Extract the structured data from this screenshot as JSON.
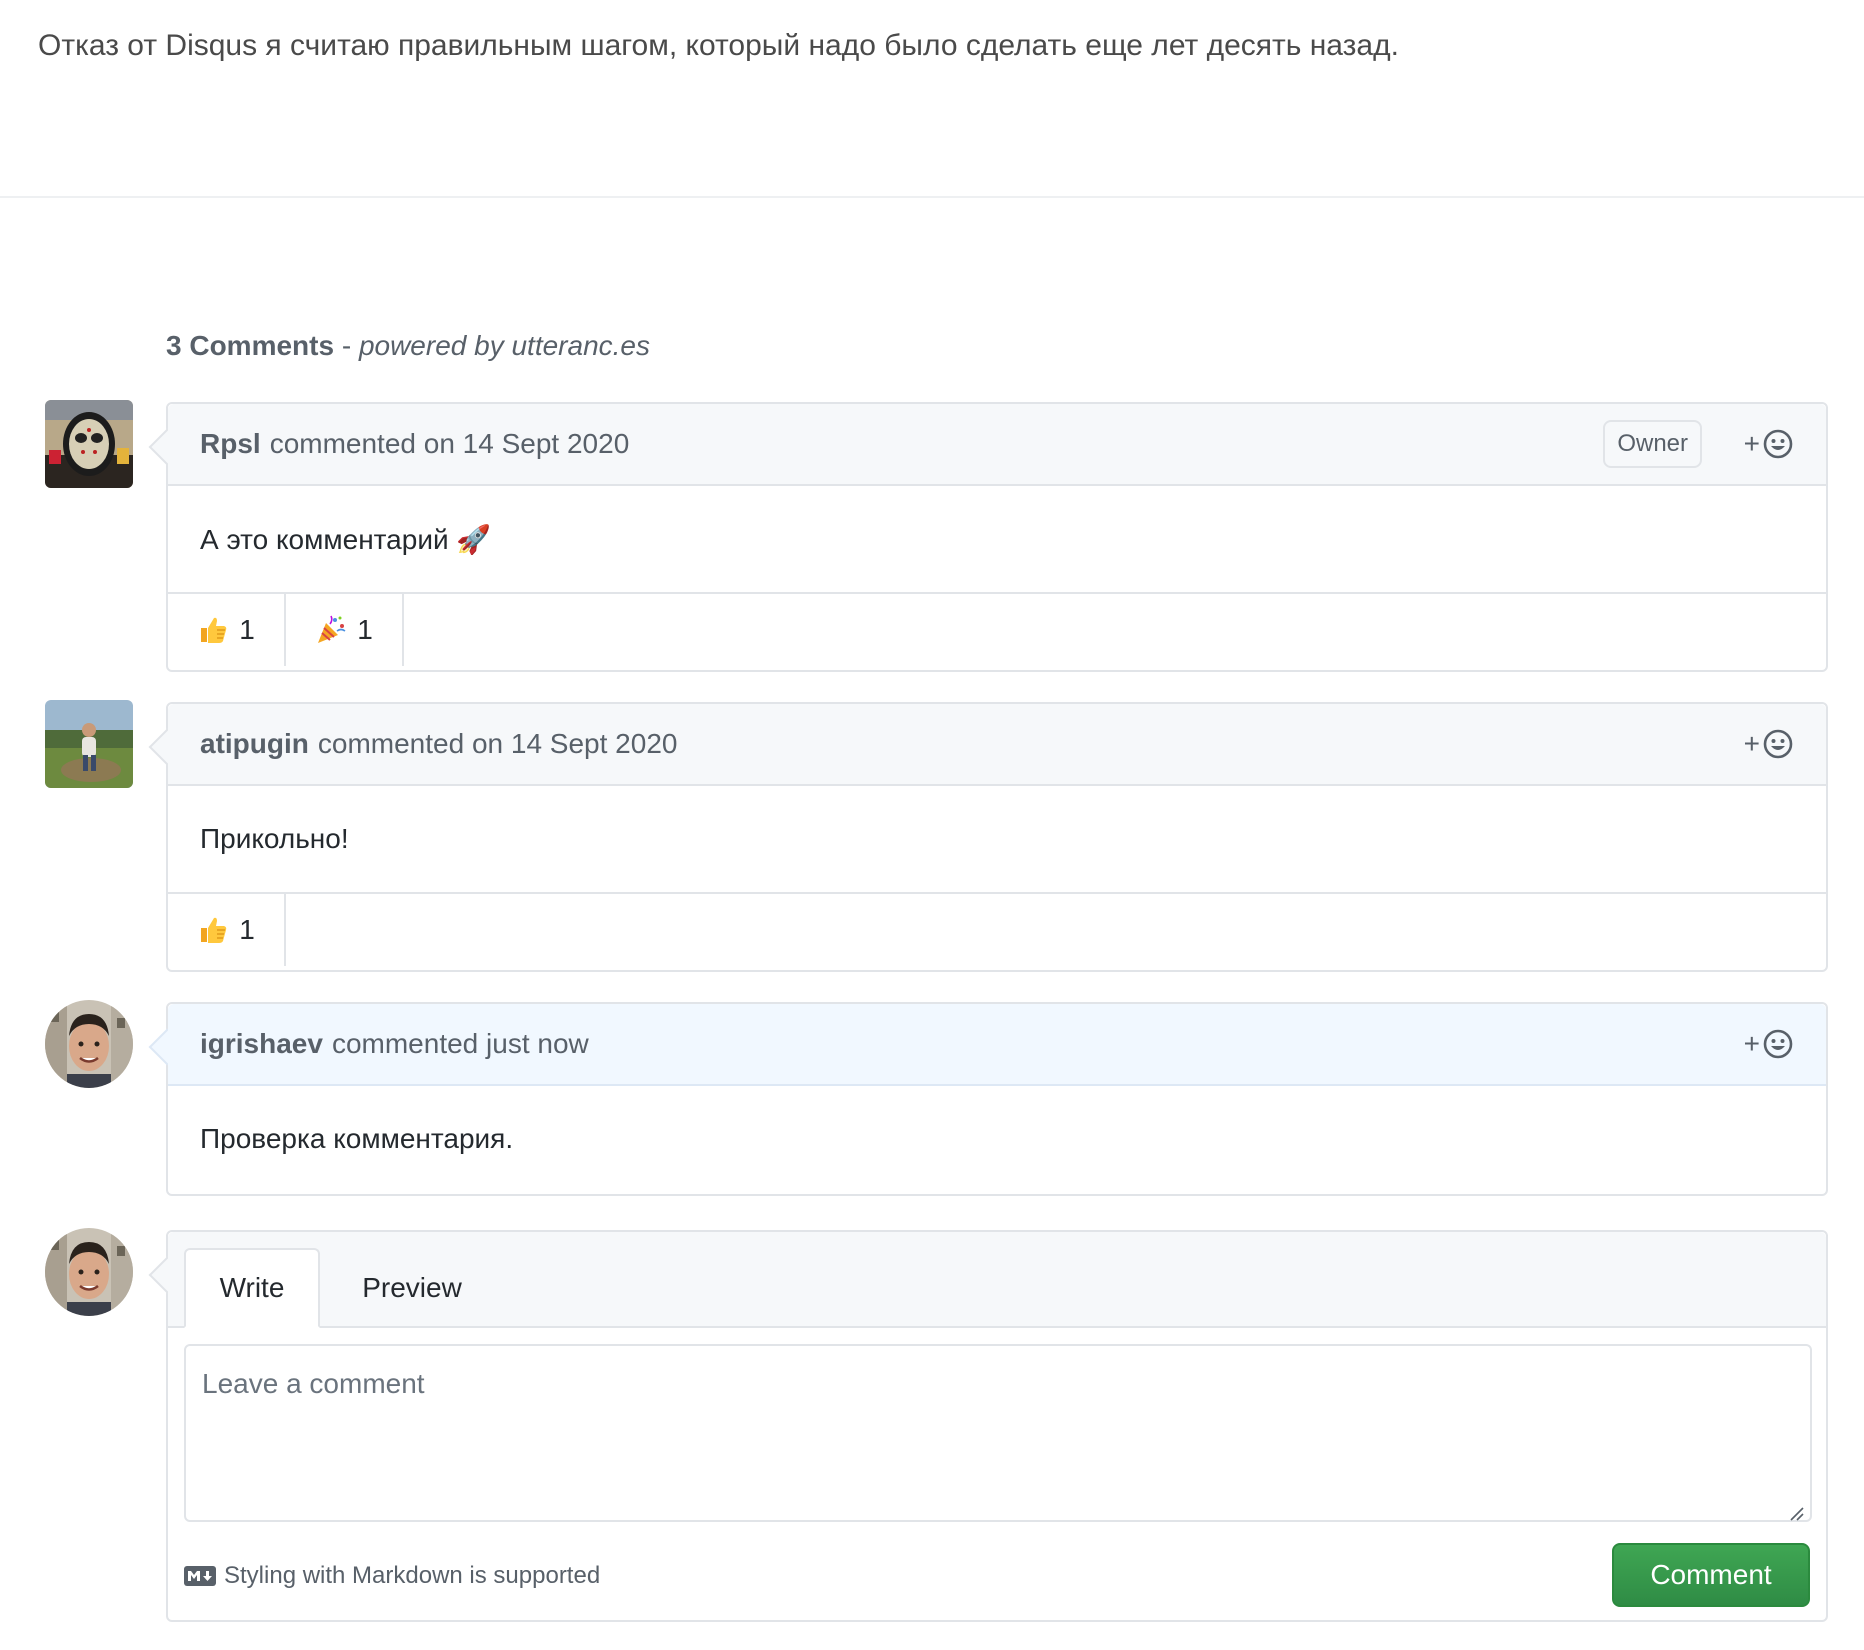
{
  "intro_text": "Отказ от Disqus я считаю правильным шагом, который надо было сделать еще лет десять назад.",
  "thread": {
    "count_label": "3 Comments",
    "separator": " - ",
    "powered_by": "powered by utteranc.es"
  },
  "comments": [
    {
      "author": "Rpsl",
      "meta": "commented on 14 Sept 2020",
      "badge": "Owner",
      "body": "А это комментарий 🚀",
      "reactions": [
        {
          "emoji": "thumbs-up",
          "count": "1"
        },
        {
          "emoji": "party-popper",
          "count": "1"
        }
      ]
    },
    {
      "author": "atipugin",
      "meta": "commented on 14 Sept 2020",
      "body": "Прикольно!",
      "reactions": [
        {
          "emoji": "thumbs-up",
          "count": "1"
        }
      ]
    },
    {
      "author": "igrishaev",
      "meta": "commented just now",
      "body": "Проверка комментария."
    }
  ],
  "add_reaction_label": "+",
  "compose": {
    "tab_write": "Write",
    "tab_preview": "Preview",
    "placeholder": "Leave a comment",
    "markdown_hint": "Styling with Markdown is supported",
    "submit_label": "Comment"
  },
  "colors": {
    "accent_green": "#2ea44f",
    "header_bg": "#f6f8fa",
    "current_user_header_bg": "#f1f8ff",
    "border": "#e1e4e8",
    "muted_text": "#586069"
  }
}
